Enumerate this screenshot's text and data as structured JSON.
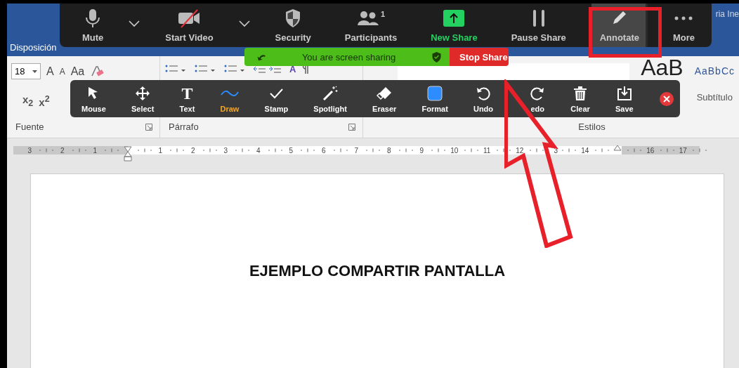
{
  "word": {
    "user_name": "ria Ine",
    "tabs": [
      {
        "label": "Disposición"
      }
    ],
    "font_group": {
      "label": "Fuente",
      "font_size": "18",
      "row1": [
        "A",
        "A",
        "Aa"
      ],
      "row2": [
        "x$_{2}$",
        "x$^{2}$"
      ]
    },
    "paragraph_group": {
      "label": "Párrafo",
      "sort_label": "A"
    },
    "styles_group": {
      "label": "Estilos",
      "previews": [
        {
          "text": "AaB",
          "kind": "big"
        },
        {
          "text": "AaBbCc",
          "kind": "normal"
        }
      ],
      "subtitle": "Subtítulo"
    },
    "ruler": [
      {
        "kind": "number",
        "label": "3"
      },
      {
        "kind": "number",
        "label": "2"
      },
      {
        "kind": "number",
        "label": "1"
      },
      {
        "kind": "marker"
      },
      {
        "kind": "number",
        "label": "1"
      },
      {
        "kind": "number",
        "label": "2"
      },
      {
        "kind": "number",
        "label": "3"
      },
      {
        "kind": "number",
        "label": "4"
      },
      {
        "kind": "number",
        "label": "5"
      },
      {
        "kind": "number",
        "label": "6"
      },
      {
        "kind": "number",
        "label": "7"
      },
      {
        "kind": "number",
        "label": "8"
      },
      {
        "kind": "number",
        "label": "9"
      },
      {
        "kind": "number",
        "label": "10"
      },
      {
        "kind": "number",
        "label": "11"
      },
      {
        "kind": "number",
        "label": "12"
      },
      {
        "kind": "number",
        "label": "3"
      },
      {
        "kind": "number",
        "label": "14"
      },
      {
        "kind": "marker"
      },
      {
        "kind": "number",
        "label": "16"
      },
      {
        "kind": "number",
        "label": "17"
      }
    ],
    "document_text": "EJEMPLO COMPARTIR PANTALLA"
  },
  "meeting_toolbar": [
    {
      "kind": "mic",
      "label": "Mute",
      "selected": false
    },
    {
      "kind": "chevron"
    },
    {
      "kind": "video",
      "label": "Start Video",
      "selected": false
    },
    {
      "kind": "chevron"
    },
    {
      "kind": "shield",
      "label": "Security",
      "selected": false
    },
    {
      "kind": "people",
      "label": "Participants",
      "count": "1",
      "selected": false
    },
    {
      "kind": "new_share",
      "label": "New Share",
      "selected": false
    },
    {
      "kind": "pause",
      "label": "Pause Share",
      "selected": false
    },
    {
      "kind": "pencil",
      "label": "Annotate",
      "selected": true
    },
    {
      "kind": "dots",
      "label": "More",
      "selected": false
    }
  ],
  "sharing_banner": {
    "text": "You are screen sharing",
    "stop_label": "Stop Share"
  },
  "annotation_toolbar": [
    {
      "kind": "mouse",
      "label": "Mouse",
      "selected": false
    },
    {
      "kind": "select",
      "label": "Select",
      "selected": false
    },
    {
      "kind": "text",
      "label": "Text",
      "glyph": "T",
      "selected": false
    },
    {
      "kind": "draw",
      "label": "Draw",
      "selected": true
    },
    {
      "kind": "stamp",
      "label": "Stamp",
      "selected": false
    },
    {
      "kind": "spotlight",
      "label": "Spotlight",
      "selected": false
    },
    {
      "kind": "eraser",
      "label": "Eraser",
      "selected": false
    },
    {
      "kind": "format",
      "label": "Format",
      "selected": false
    },
    {
      "kind": "undo",
      "label": "Undo",
      "selected": false
    },
    {
      "kind": "redo",
      "label": "edo",
      "selected": false
    },
    {
      "kind": "clear",
      "label": "Clear",
      "selected": false
    },
    {
      "kind": "save",
      "label": "Save",
      "selected": false
    },
    {
      "kind": "close",
      "selected": false
    }
  ]
}
